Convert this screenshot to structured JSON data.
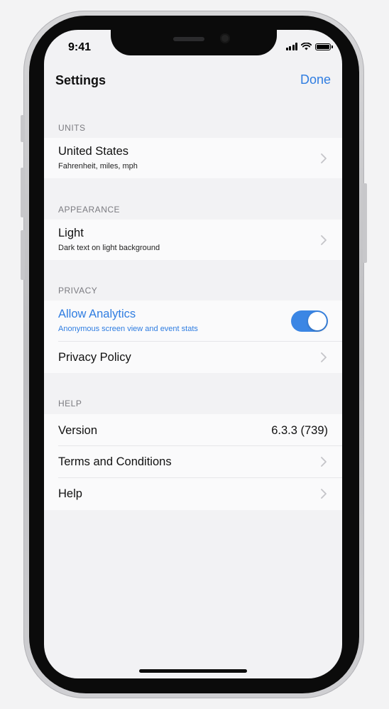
{
  "status_bar": {
    "time": "9:41"
  },
  "nav": {
    "title": "Settings",
    "done_label": "Done"
  },
  "sections": {
    "units": {
      "header": "UNITS",
      "row": {
        "title": "United States",
        "subtitle": "Fahrenheit, miles, mph"
      }
    },
    "appearance": {
      "header": "APPEARANCE",
      "row": {
        "title": "Light",
        "subtitle": "Dark text on light background"
      }
    },
    "privacy": {
      "header": "PRIVACY",
      "analytics": {
        "title": "Allow Analytics",
        "subtitle": "Anonymous screen view and event stats",
        "enabled": true
      },
      "policy": {
        "title": "Privacy Policy"
      }
    },
    "help": {
      "header": "HELP",
      "version": {
        "title": "Version",
        "value": "6.3.3 (739)"
      },
      "terms": {
        "title": "Terms and Conditions"
      },
      "help": {
        "title": "Help"
      }
    }
  },
  "colors": {
    "accent": "#2f7de1",
    "toggle_on": "#3b86e4",
    "background": "#f2f2f4"
  },
  "icons": {
    "chevron": "chevron-right-icon"
  }
}
